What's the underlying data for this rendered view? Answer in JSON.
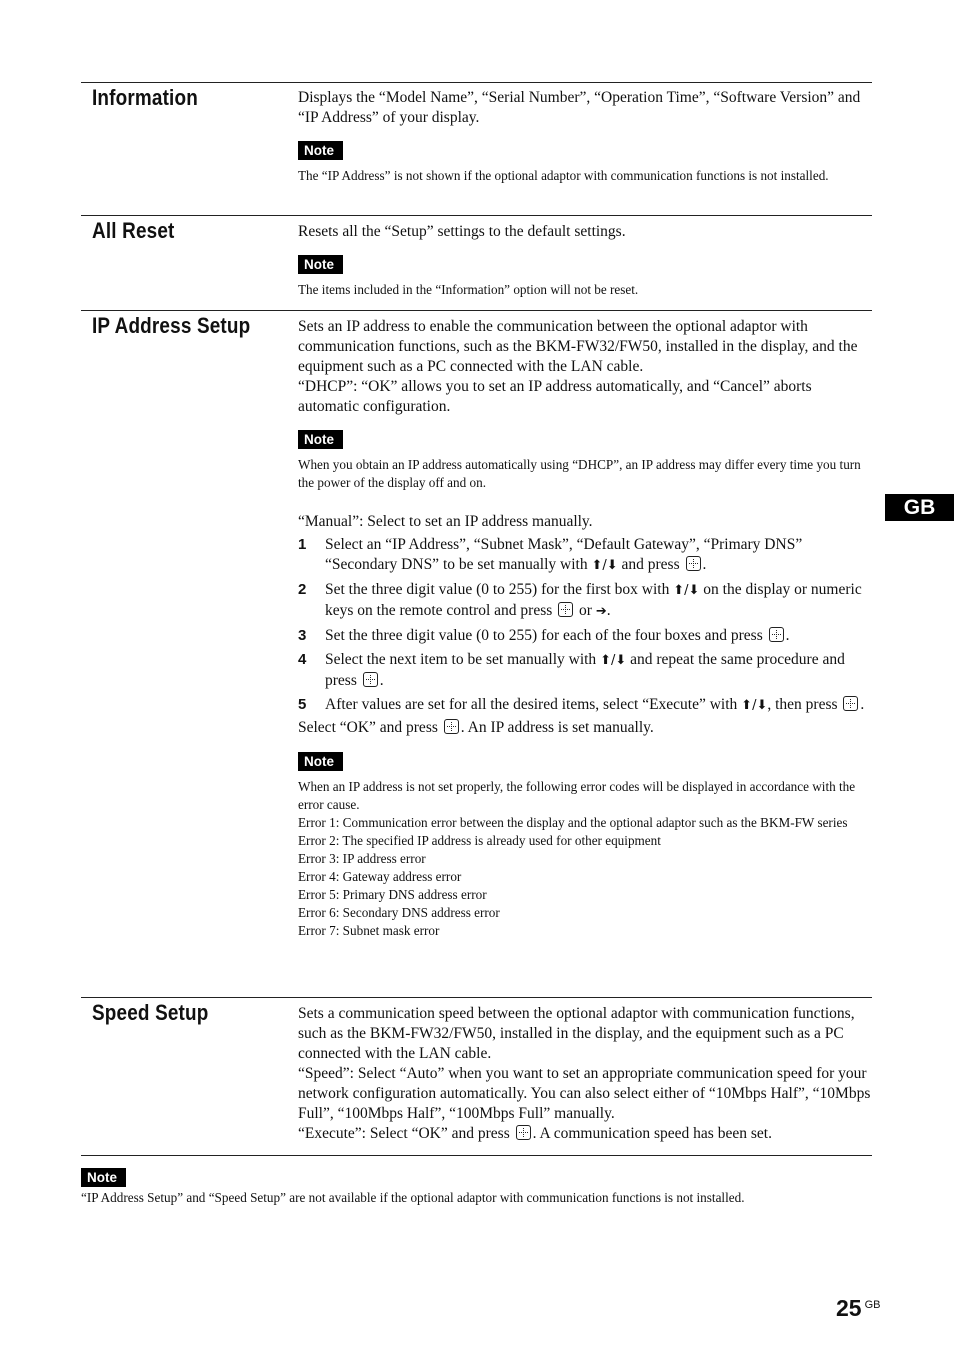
{
  "sections": {
    "information": {
      "title": "Information",
      "body": "Displays the “Model Name”, “Serial Number”, “Operation Time”, “Software Version” and “IP Address” of your display.",
      "note_label": "Note",
      "note": "The “IP Address” is not shown if the optional adaptor with communication functions is not installed."
    },
    "all_reset": {
      "title": "All Reset",
      "body": "Resets all the “Setup” settings to the default settings.",
      "note_label": "Note",
      "note": "The items included in the “Information” option will not be reset."
    },
    "ip_address_setup": {
      "title": "IP Address Setup",
      "body1": "Sets an IP address to enable the communication between the optional adaptor with communication functions, such as the BKM-FW32/FW50, installed in the display, and the equipment such as a PC connected with the LAN cable.",
      "body2": "“DHCP”: “OK” allows you to set an IP address automatically, and “Cancel” aborts automatic configuration.",
      "note1_label": "Note",
      "note1": "When you obtain an IP address automatically using “DHCP”, an IP address may differ every time you turn the power of the display off and on.",
      "manual_intro": "“Manual”: Select to set an IP address manually.",
      "steps": [
        {
          "num": "1",
          "a": "Select an “IP Address”, “Subnet Mask”, “Default Gateway”, “Primary DNS” “Secondary DNS” to be set manually with ",
          "b": " and press ",
          "c": "."
        },
        {
          "num": "2",
          "a": "Set the three digit value (0 to 255) for the first box with ",
          "b": " on the display or numeric keys on the remote control and press ",
          "c": " or ",
          "d": "."
        },
        {
          "num": "3",
          "a": "Set the three digit value (0 to 255) for each of the four boxes and press ",
          "c": "."
        },
        {
          "num": "4",
          "a": "Select the next item to be set manually with ",
          "b": " and repeat the same procedure and press ",
          "c": "."
        },
        {
          "num": "5",
          "a": "After values are set for all the desired items, select “Execute” with ",
          "b": ", then press ",
          "c": "."
        }
      ],
      "final_a": "Select “OK” and press ",
      "final_b": ". An IP address is set manually.",
      "note2_label": "Note",
      "note2_lines": [
        "When an IP address is not set properly, the following error codes will be displayed in accordance with the error cause.",
        "Error 1: Communication error between the display and the optional adaptor such as the BKM-FW series",
        "Error 2: The specified IP address is already used for other equipment",
        "Error 3: IP address error",
        "Error 4: Gateway address error",
        "Error 5: Primary DNS address error",
        "Error 6: Secondary DNS address error",
        "Error 7: Subnet mask error"
      ]
    },
    "speed_setup": {
      "title": "Speed Setup",
      "body1": "Sets a communication speed between the optional adaptor with communication functions, such as the BKM-FW32/FW50, installed in the display, and the equipment such as a PC connected with the LAN cable.",
      "body2": "“Speed”: Select “Auto” when you want to set an appropriate communication speed for your network configuration automatically. You can also select either of “10Mbps Half”, “10Mbps Full”, “100Mbps Half”, “100Mbps Full” manually.",
      "body3_a": "“Execute”: Select “OK” and press ",
      "body3_b": ". A communication speed has been set."
    }
  },
  "footer_note": {
    "label": "Note",
    "text": "“IP Address Setup” and “Speed Setup” are not available if the optional adaptor with communication functions is not installed."
  },
  "symbols": {
    "updown": "🡅/🡇",
    "right": "➔"
  },
  "side_tab": "GB",
  "page": {
    "number": "25",
    "suffix": "GB"
  }
}
